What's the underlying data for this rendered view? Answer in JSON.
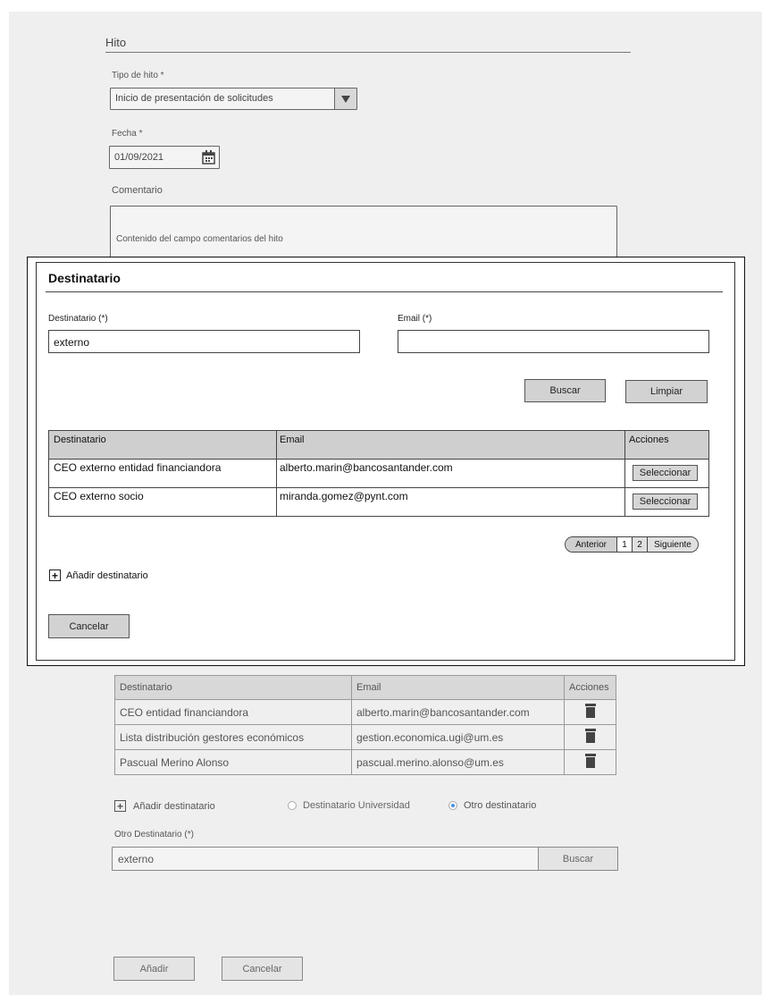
{
  "hito": {
    "section_title": "Hito",
    "tipo_label": "Tipo de hito *",
    "tipo_value": "Inicio de presentación de solicitudes",
    "fecha_label": "Fecha *",
    "fecha_value": "01/09/2021",
    "comentario_label": "Comentario",
    "comentario_value": "Contenido del campo comentarios del hito"
  },
  "modal": {
    "title": "Destinatario",
    "dest_label": "Destinatario (*)",
    "dest_value": "externo",
    "email_label": "Email (*)",
    "email_value": "",
    "buscar_label": "Buscar",
    "limpiar_label": "Limpiar",
    "table": {
      "headers": [
        "Destinatario",
        "Email",
        "Acciones"
      ],
      "rows": [
        {
          "destinatario": "CEO externo entidad financiandora",
          "email": "alberto.marin@bancosantander.com",
          "action": "Seleccionar"
        },
        {
          "destinatario": "CEO externo socio",
          "email": "miranda.gomez@pynt.com",
          "action": "Seleccionar"
        }
      ]
    },
    "pagination": {
      "prev": "Anterior",
      "pages": [
        "1",
        "2"
      ],
      "next": "Siguiente"
    },
    "add_label": "Añadir destinatario",
    "cancel_label": "Cancelar"
  },
  "bg_table": {
    "headers": [
      "Destinatario",
      "Email",
      "Acciones"
    ],
    "rows": [
      {
        "destinatario": "CEO entidad financiandora",
        "email": "alberto.marin@bancosantander.com"
      },
      {
        "destinatario": "Lista distribución gestores económicos",
        "email": "gestion.economica.ugi@um.es"
      },
      {
        "destinatario": "Pascual Merino Alonso",
        "email": "pascual.merino.alonso@um.es"
      }
    ]
  },
  "bottom": {
    "add_label": "Añadir destinatario",
    "radio_univ": "Destinatario Universidad",
    "radio_otro": "Otro destinatario",
    "otro_label": "Otro Destinatario (*)",
    "otro_value": "externo",
    "buscar_label": "Buscar",
    "anadir_label": "Añadir",
    "cancelar_label": "Cancelar"
  },
  "icons": {
    "calendar": "calendar-icon",
    "dropdown": "triangle-down-icon",
    "trash": "trash-icon",
    "plus": "plus-box-icon"
  },
  "colors": {
    "background": "#efefef",
    "header_fill": "#cfcfcf",
    "radio_selected": "#4a90e2"
  }
}
